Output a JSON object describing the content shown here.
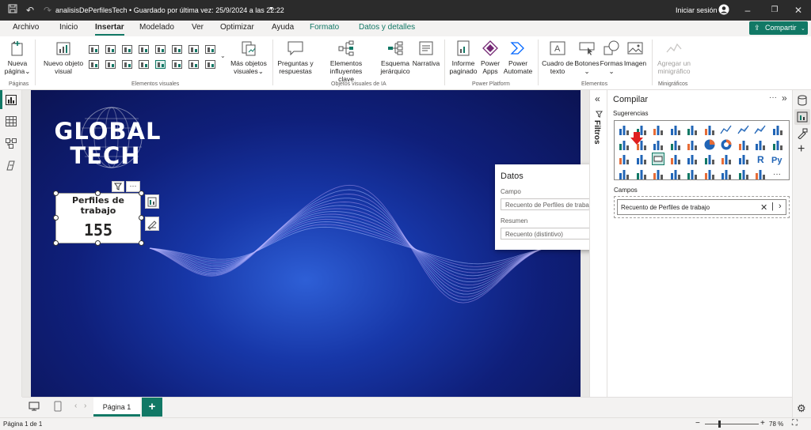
{
  "titlebar": {
    "doc_title": "analisisDePerfilesTech • Guardado por última vez: 25/9/2024 a las 22:22",
    "signin": "Iniciar sesión"
  },
  "tabs": [
    "Archivo",
    "Inicio",
    "Insertar",
    "Modelado",
    "Ver",
    "Optimizar",
    "Ayuda",
    "Formato",
    "Datos y detalles"
  ],
  "share_label": "Compartir",
  "ribbon": {
    "nueva_pagina": [
      "Nueva",
      "página"
    ],
    "nuevo_objeto": [
      "Nuevo objeto",
      "visual"
    ],
    "mas_objetos": [
      "Más objetos",
      "visuales"
    ],
    "preguntas": [
      "Preguntas y",
      "respuestas"
    ],
    "elementos_influyentes": [
      "Elementos influyentes",
      "clave"
    ],
    "esquema": [
      "Esquema",
      "jerárquico"
    ],
    "narrativa": "Narrativa",
    "informe": [
      "Informe",
      "paginado"
    ],
    "power_apps": [
      "Power",
      "Apps"
    ],
    "power_automate": [
      "Power",
      "Automate"
    ],
    "cuadro_texto": [
      "Cuadro de",
      "texto"
    ],
    "botones": "Botones",
    "formas": "Formas",
    "imagen": "Imagen",
    "agregar_minigrafico": [
      "Agregar un",
      "minigráfico"
    ],
    "groups": {
      "paginas": "Páginas",
      "elementos_visuales": "Elementos visuales",
      "ia": "Objetos visuales de IA",
      "power_platform": "Power Platform",
      "elementos": "Elementos",
      "minigraficos": "Minigráficos"
    }
  },
  "canvas": {
    "logo_line1": "GLOBAL",
    "logo_line2": "TECH",
    "card_title_1": "Perfiles de",
    "card_title_2": "trabajo",
    "card_value": "155"
  },
  "filters_label": "Filtros",
  "datos_popup": {
    "title": "Datos",
    "campo_label": "Campo",
    "campo_value": "Recuento de Perfiles de trabajo",
    "resumen_label": "Resumen",
    "resumen_value": "Recuento (distintivo)"
  },
  "build_pane": {
    "title": "Compilar",
    "sugerencias": "Sugerencias",
    "campos": "Campos",
    "field_value": "Recuento de Perfiles de trabajo"
  },
  "pages": {
    "tab1": "Página 1"
  },
  "status": {
    "page": "Página 1 de 1",
    "zoom": "78 %"
  },
  "colors": {
    "accent": "#117865",
    "titlebar": "#2b2b2b",
    "canvas_dark": "#0b1352",
    "canvas_light": "#2e5fd6"
  }
}
